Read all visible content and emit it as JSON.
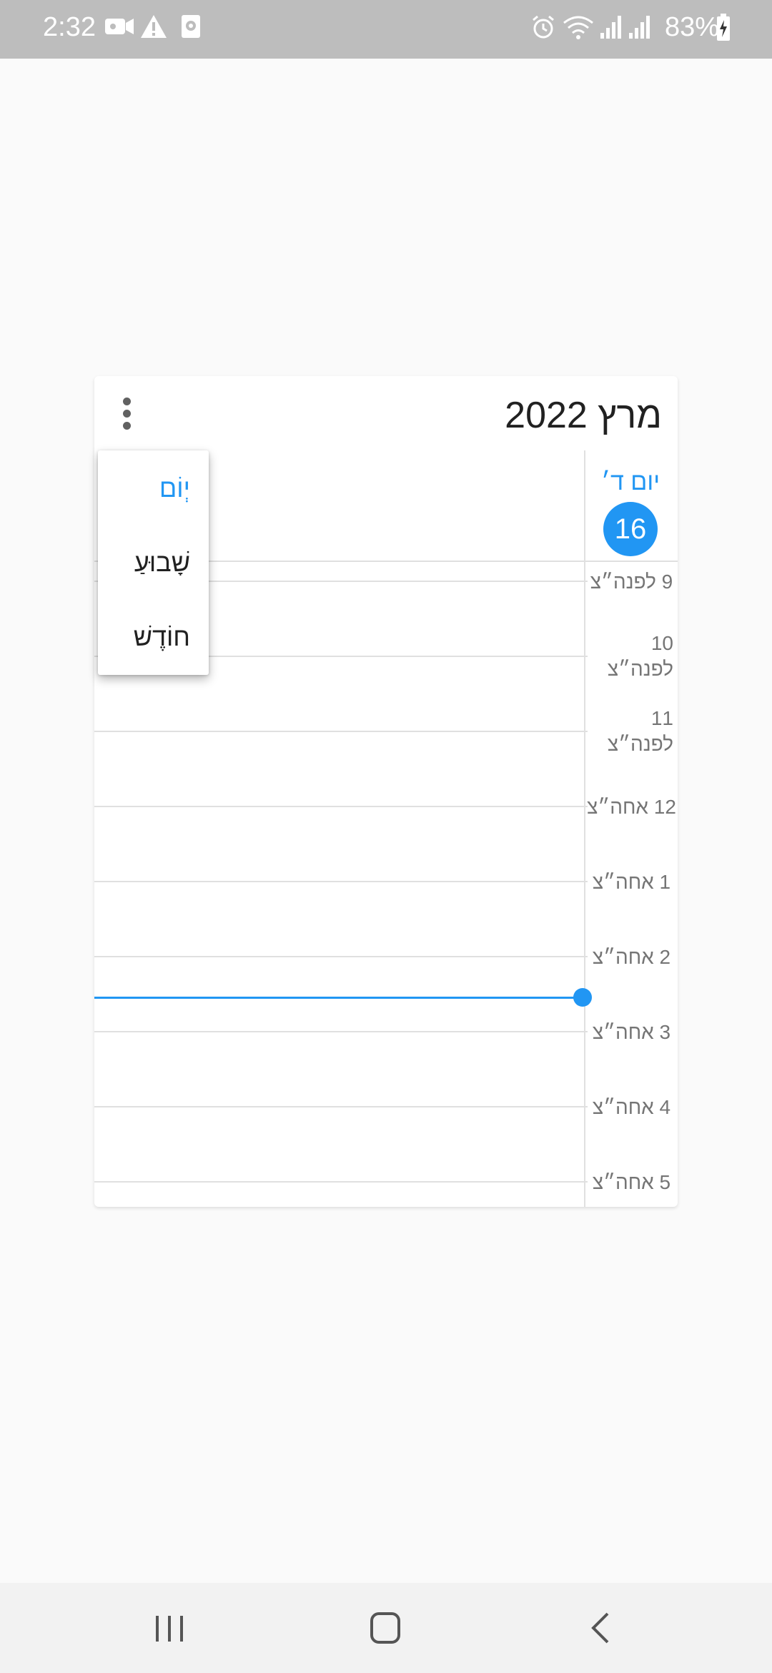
{
  "status_bar": {
    "time": "2:32",
    "battery": "83%",
    "icons": [
      "video-camera-icon",
      "warning-icon",
      "screen-record-icon",
      "alarm-icon",
      "wifi-icon",
      "signal-icon",
      "signal-icon",
      "battery-charging-icon"
    ]
  },
  "widget": {
    "title": "מרץ 2022",
    "day": {
      "label": "יום ד׳",
      "number": "16"
    },
    "hours": [
      {
        "label": "9 לפנה״צ"
      },
      {
        "label": "10\nלפנה״צ"
      },
      {
        "label": "11\nלפנה״צ"
      },
      {
        "label": "12 אחה״צ"
      },
      {
        "label": "1 אחה״צ"
      },
      {
        "label": "2 אחה״צ"
      },
      {
        "label": "3 אחה״צ"
      },
      {
        "label": "4 אחה״צ"
      },
      {
        "label": "5 אחה״צ"
      }
    ]
  },
  "menu": {
    "items": [
      {
        "label": "יְוֹם",
        "selected": true
      },
      {
        "label": "שָׁבוּעַ",
        "selected": false
      },
      {
        "label": "חוֹדֶשׁ",
        "selected": false
      }
    ]
  },
  "colors": {
    "accent": "#2196f3",
    "status_bar": "#bdbdbd"
  },
  "nav_bar": {
    "icons": [
      "recent-apps-icon",
      "home-icon",
      "back-icon"
    ]
  }
}
